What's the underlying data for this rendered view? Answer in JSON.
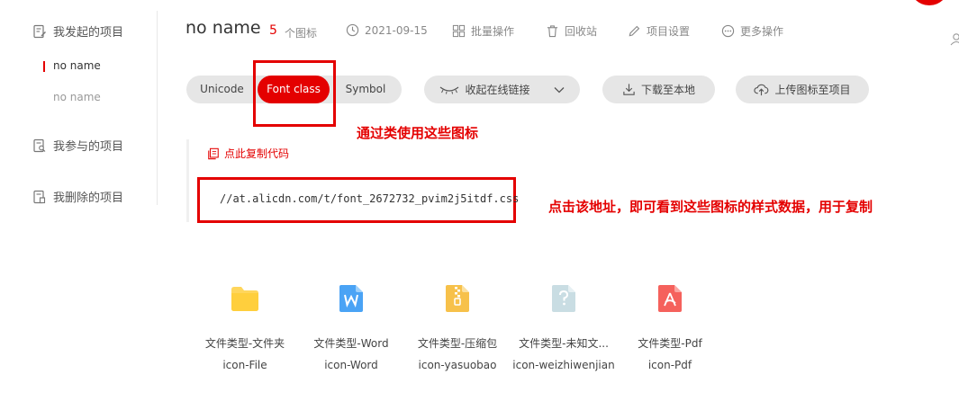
{
  "sidebar": {
    "groups": [
      {
        "label": "我发起的项目",
        "icon": "edit-doc-icon"
      },
      {
        "label": "我参与的项目",
        "icon": "search-doc-icon"
      },
      {
        "label": "我删除的项目",
        "icon": "trash-doc-icon"
      }
    ],
    "sub_items": [
      "no name",
      "no name"
    ]
  },
  "header": {
    "title": "no name",
    "count": "5",
    "count_unit": "个图标",
    "date": "2021-09-15",
    "batch": "批量操作",
    "recycle": "回收站",
    "settings": "项目设置",
    "more": "更多操作"
  },
  "tabs": [
    "Unicode",
    "Font class",
    "Symbol"
  ],
  "actions": {
    "collapse_link": "收起在线链接",
    "download": "下载至本地",
    "upload": "上传图标至项目"
  },
  "annotations": {
    "class_usage": "通过类使用这些图标",
    "address_hint": "点击该地址，即可看到这些图标的样式数据，用于复制"
  },
  "code": {
    "copy_label": "点此复制代码",
    "css_url": "//at.alicdn.com/t/font_2672732_pvim2j5itdf.css"
  },
  "icons": [
    {
      "name": "文件类型-文件夹",
      "code": "icon-File",
      "color": "#ffd65c"
    },
    {
      "name": "文件类型-Word",
      "code": "icon-Word",
      "color": "#4aa3f5"
    },
    {
      "name": "文件类型-压缩包",
      "code": "icon-yasuobao",
      "color": "#f7c14a"
    },
    {
      "name": "文件类型-未知文...",
      "code": "icon-weizhiwenjian",
      "color": "#c9dde3"
    },
    {
      "name": "文件类型-Pdf",
      "code": "icon-Pdf",
      "color": "#f5615c"
    }
  ],
  "colors": {
    "accent": "#e40000",
    "pill_bg": "#e6e6e6"
  }
}
